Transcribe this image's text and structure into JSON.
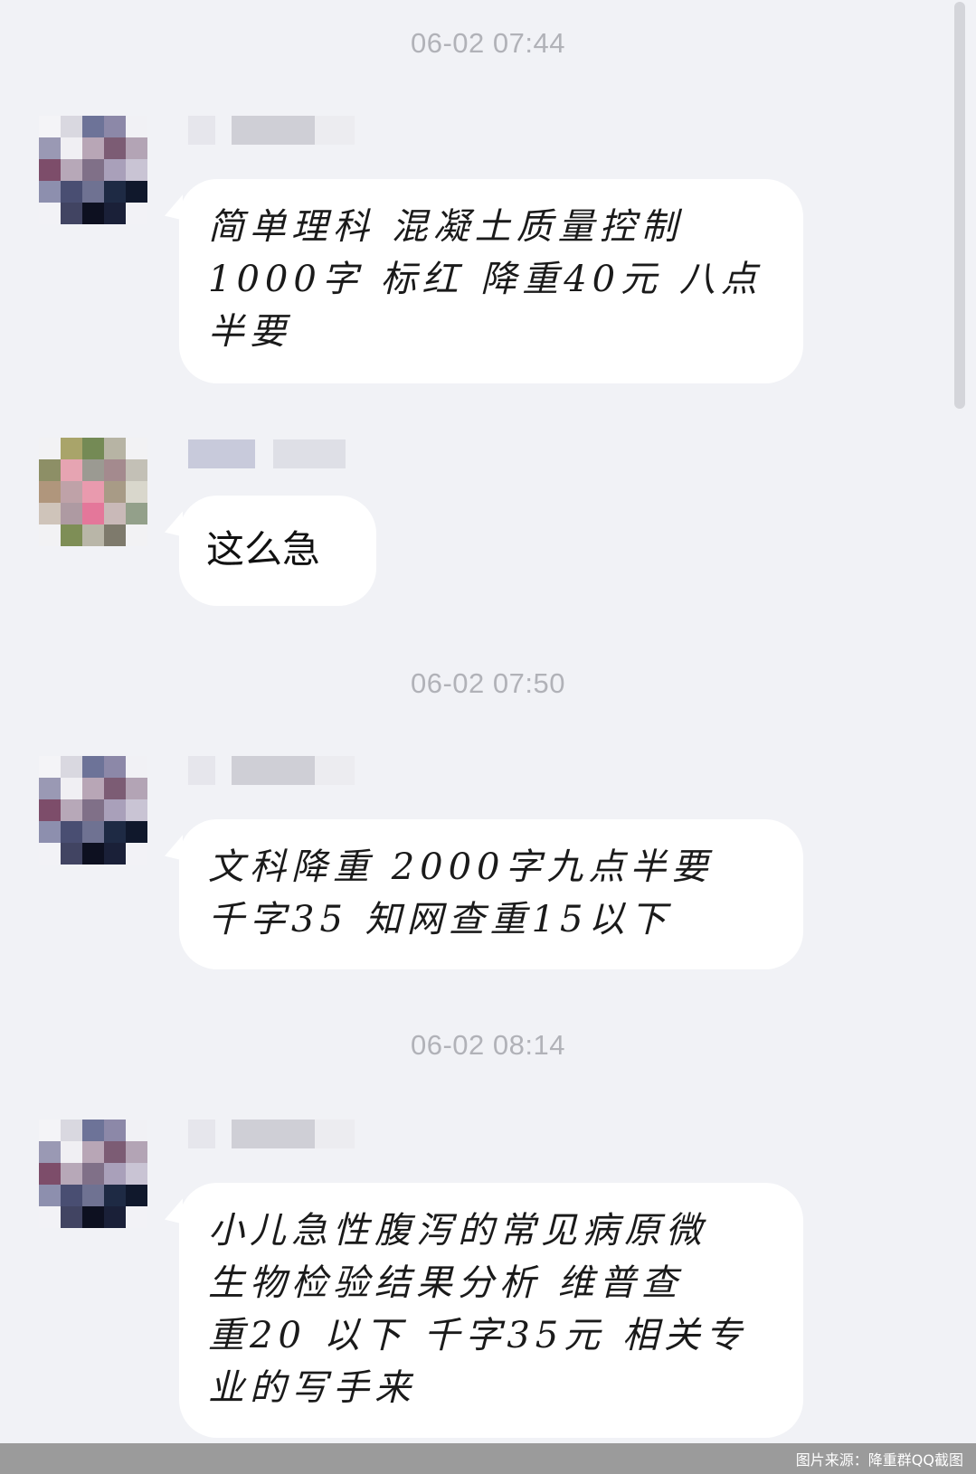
{
  "messages": [
    {
      "timestamp": "06-02 07:44",
      "text": "简单理科 混凝土质量控制\n1000字 标红 降重40元 八点\n半要"
    },
    {
      "text": "这么急"
    },
    {
      "timestamp": "06-02 07:50",
      "text": "文科降重 2000字九点半要\n千字35 知网查重15以下"
    },
    {
      "timestamp": "06-02 08:14",
      "text": "小儿急性腹泻的常见病原微\n生物检验结果分析 维普查\n重20 以下 千字35元 相关专\n业的写手来"
    }
  ],
  "footer": {
    "credit": "图片来源：降重群QQ截图"
  },
  "colors": {
    "background": "#f1f2f6",
    "bubble": "#ffffff",
    "timestamp": "#b1b2b8",
    "footer_bar": "#9b9b9b"
  }
}
